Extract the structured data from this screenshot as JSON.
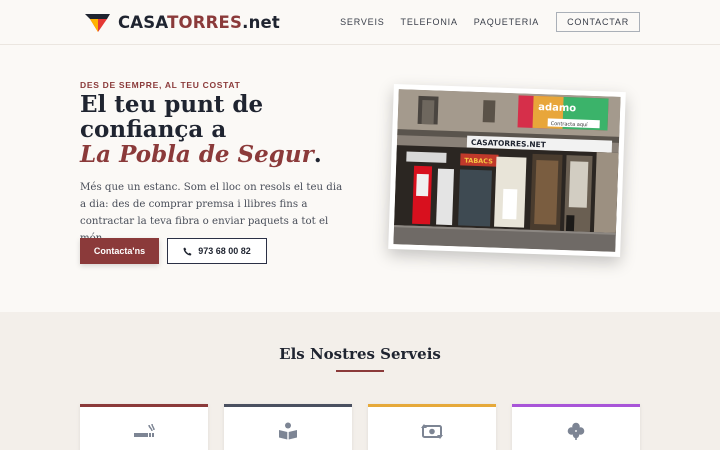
{
  "brand": {
    "part1": "CASA",
    "part2": "TORRES",
    "part3": ".net"
  },
  "nav": {
    "items": [
      "SERVEIS",
      "TELEFONIA",
      "PAQUETERIA"
    ],
    "cta": "CONTACTAR"
  },
  "hero": {
    "eyebrow": "DES DE SEMPRE, AL TEU COSTAT",
    "title_line1": "El teu punt de",
    "title_line2": "confiança a",
    "title_highlight": "La Pobla de Segur",
    "title_end": ".",
    "description": "Més que un estanc. Som el lloc on resols el teu dia a dia: des de comprar premsa i llibres fins a contractar la teva fibra o enviar paquets a tot el món.",
    "primary_button": "Contacta'ns",
    "phone_button": "973 68 00 82"
  },
  "photo": {
    "sign_main": "CASATORRES.NET",
    "sign_tabacs": "TABACS",
    "sign_adamo": "adamo",
    "sign_contracta": "Contracta aquí"
  },
  "services": {
    "title": "Els Nostres Serveis",
    "cards": [
      {
        "icon": "smoking-icon",
        "color": "#8b3a3a"
      },
      {
        "icon": "book-reader-icon",
        "color": "#4a5060"
      },
      {
        "icon": "money-exchange-icon",
        "color": "#e6a93a"
      },
      {
        "icon": "clover-icon",
        "color": "#a855d8"
      }
    ]
  },
  "colors": {
    "accent": "#8b3a3a",
    "dark": "#1f2430",
    "background": "#fbf9f6",
    "section": "#f3efea"
  }
}
